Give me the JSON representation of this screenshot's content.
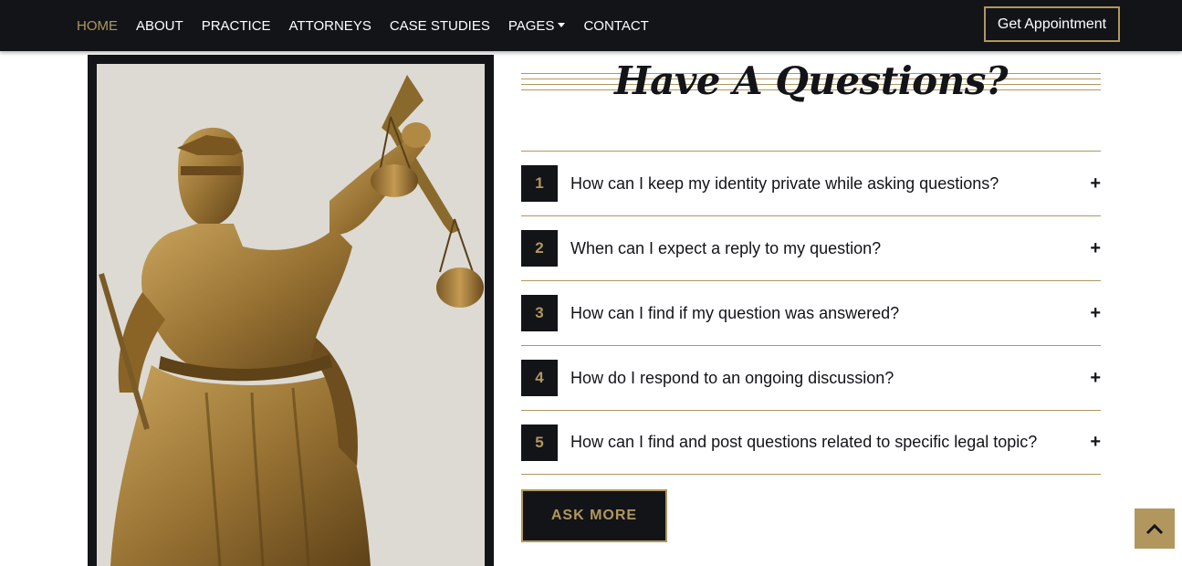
{
  "nav": {
    "items": [
      {
        "label": "HOME",
        "active": true
      },
      {
        "label": "ABOUT"
      },
      {
        "label": "PRACTICE"
      },
      {
        "label": "ATTORNEYS"
      },
      {
        "label": "CASE STUDIES"
      },
      {
        "label": "PAGES",
        "dropdown": true
      },
      {
        "label": "CONTACT"
      }
    ],
    "cta": "Get Appointment"
  },
  "faq": {
    "heading": "Have A Questions?",
    "items": [
      {
        "num": "1",
        "question": "How can I keep my identity private while asking questions?"
      },
      {
        "num": "2",
        "question": "When can I expect a reply to my question?"
      },
      {
        "num": "3",
        "question": "How can I find if my question was answered?"
      },
      {
        "num": "4",
        "question": "How do I respond to an ongoing discussion?"
      },
      {
        "num": "5",
        "question": "How can I find and post questions related to specific legal topic?"
      }
    ],
    "expand_icon": "plus-icon",
    "button": "ASK MORE"
  },
  "scroll_top_icon": "chevron-up-icon",
  "colors": {
    "accent": "#b1975e",
    "dark": "#121418",
    "background": "#ffffff"
  }
}
